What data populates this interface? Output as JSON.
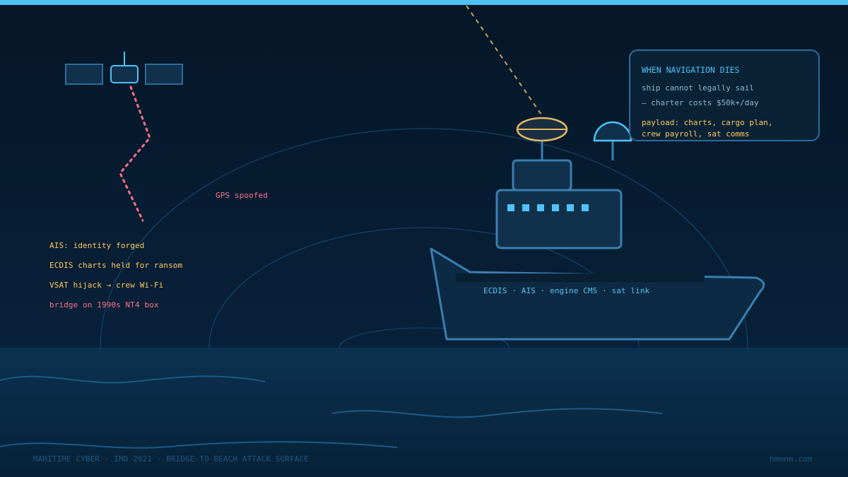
{
  "labels": {
    "gps_spoofed": "GPS spoofed",
    "ais": "AIS: identity forged",
    "ecdis": "ECDIS charts held for ransom",
    "vsat": "VSAT hijack → crew Wi-Fi",
    "bridge": "bridge on 1990s NT4 box",
    "ship_systems": "ECDIS · AIS · engine CMS · sat link"
  },
  "callout": {
    "title": "WHEN NAVIGATION DIES",
    "line1": "ship cannot legally sail",
    "line2": "— charter costs $50k+/day",
    "line3": "payload: charts, cargo plan,",
    "line4": "crew payroll, sat comms"
  },
  "footer": {
    "caption": "MARITIME CYBER · IMO 2021 · BRIDGE-TO-BEACH ATTACK SURFACE",
    "site": "hmmnm.com"
  },
  "icons": [
    "satellite-icon",
    "radar-dome-icon",
    "sat-dish-icon",
    "ship-icon"
  ],
  "colors": {
    "background": "#06182a",
    "accent": "#4fc3f7",
    "warning": "#ffc95c",
    "alert": "#ff6f86",
    "sea": "#0b2f49"
  }
}
